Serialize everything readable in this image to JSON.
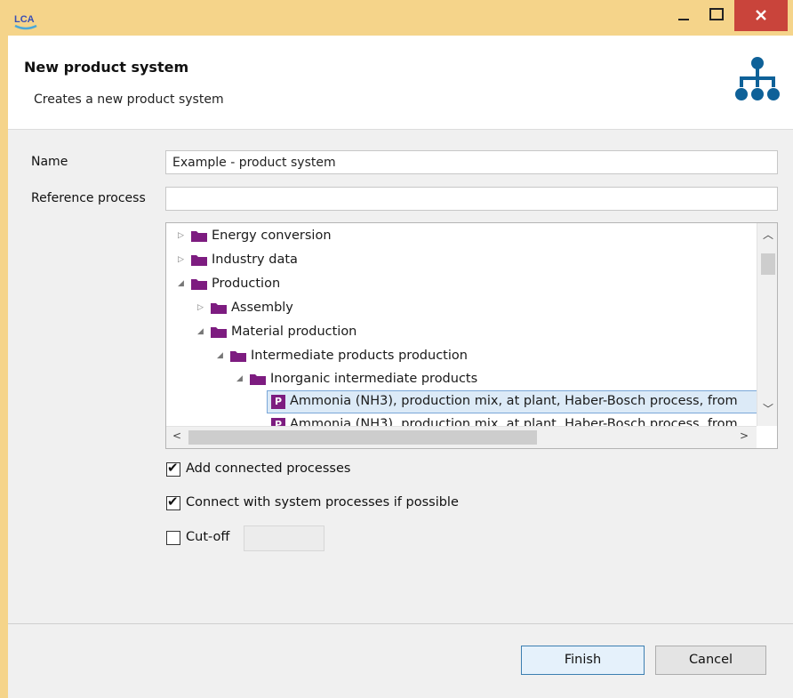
{
  "window": {
    "app_icon_text": "LCA",
    "controls": {
      "minimize": "_",
      "maximize": "□",
      "close": "✕"
    }
  },
  "header": {
    "title": "New product system",
    "subtitle": "Creates a new product system",
    "icon": "hierarchy-icon"
  },
  "form": {
    "name_label": "Name",
    "name_value": "Example - product system",
    "reference_label": "Reference process",
    "reference_value": ""
  },
  "tree": {
    "items": [
      {
        "label": "Energy conversion",
        "expanded": false
      },
      {
        "label": "Industry data",
        "expanded": false
      },
      {
        "label": "Production",
        "expanded": true
      },
      {
        "label": "Assembly",
        "expanded": false
      },
      {
        "label": "Material production",
        "expanded": true
      },
      {
        "label": "Intermediate products production",
        "expanded": true
      },
      {
        "label": "Inorganic intermediate products",
        "expanded": true
      },
      {
        "label": "Ammonia (NH3), production mix, at plant, Haber-Bosch process, from",
        "badge": "P",
        "selected": true
      },
      {
        "label": "Ammonia (NH3), production mix, at plant, Haber-Bosch process, from",
        "badge": "P"
      }
    ],
    "folder_color": "#7d1c80"
  },
  "options": {
    "add_connected": {
      "label": "Add connected processes",
      "checked": true
    },
    "connect_system": {
      "label": "Connect with system processes if possible",
      "checked": true
    },
    "cutoff": {
      "label": "Cut-off",
      "checked": false,
      "value": ""
    }
  },
  "buttons": {
    "finish": "Finish",
    "cancel": "Cancel"
  },
  "colors": {
    "titlebar": "#f5d48a",
    "close": "#c9443b",
    "accent": "#0e6198"
  }
}
